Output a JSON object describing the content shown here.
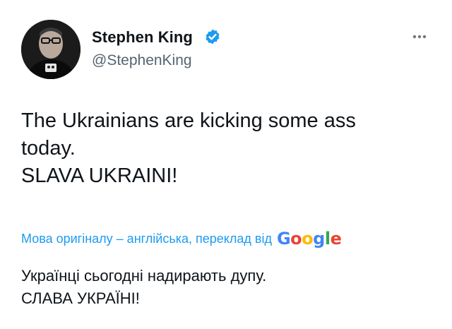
{
  "author": {
    "display_name": "Stephen King",
    "handle": "@StephenKing",
    "verified": true,
    "avatar": "avatar-photo"
  },
  "icons": {
    "verified": "verified-badge-icon",
    "more": "more-options-icon"
  },
  "tweet": {
    "lines": [
      "The Ukrainians are kicking some ass",
      "today.",
      "SLAVA UKRAINI!"
    ]
  },
  "translation": {
    "notice": "Мова оригіналу – англійська, переклад від",
    "provider_letters": [
      "G",
      "o",
      "o",
      "g",
      "l",
      "e"
    ],
    "provider_colors": [
      "#4285f4",
      "#ea4335",
      "#fbbc05",
      "#4285f4",
      "#34a853",
      "#ea4335"
    ],
    "lines": [
      "Українці сьогодні надирають дупу.",
      "СЛАВА УКРАЇНІ!"
    ]
  },
  "colors": {
    "accent": "#1d9bf0",
    "text": "#0f1419",
    "secondary": "#536471"
  }
}
